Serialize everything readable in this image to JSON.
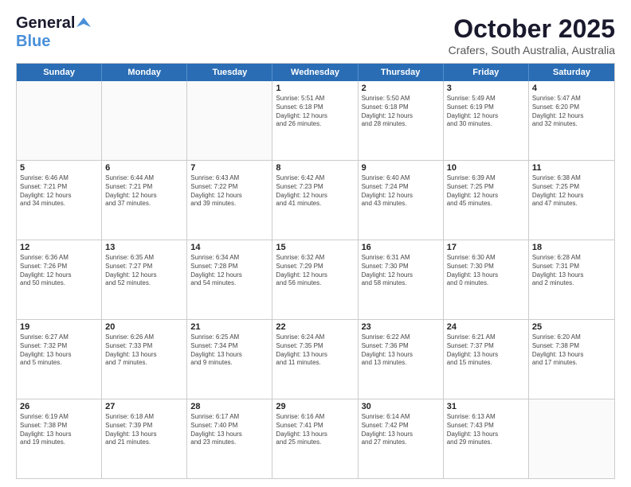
{
  "header": {
    "logo_general": "General",
    "logo_blue": "Blue",
    "month": "October 2025",
    "location": "Crafers, South Australia, Australia"
  },
  "days": [
    "Sunday",
    "Monday",
    "Tuesday",
    "Wednesday",
    "Thursday",
    "Friday",
    "Saturday"
  ],
  "rows": [
    [
      {
        "day": "",
        "info": ""
      },
      {
        "day": "",
        "info": ""
      },
      {
        "day": "",
        "info": ""
      },
      {
        "day": "1",
        "info": "Sunrise: 5:51 AM\nSunset: 6:18 PM\nDaylight: 12 hours\nand 26 minutes."
      },
      {
        "day": "2",
        "info": "Sunrise: 5:50 AM\nSunset: 6:18 PM\nDaylight: 12 hours\nand 28 minutes."
      },
      {
        "day": "3",
        "info": "Sunrise: 5:49 AM\nSunset: 6:19 PM\nDaylight: 12 hours\nand 30 minutes."
      },
      {
        "day": "4",
        "info": "Sunrise: 5:47 AM\nSunset: 6:20 PM\nDaylight: 12 hours\nand 32 minutes."
      }
    ],
    [
      {
        "day": "5",
        "info": "Sunrise: 6:46 AM\nSunset: 7:21 PM\nDaylight: 12 hours\nand 34 minutes."
      },
      {
        "day": "6",
        "info": "Sunrise: 6:44 AM\nSunset: 7:21 PM\nDaylight: 12 hours\nand 37 minutes."
      },
      {
        "day": "7",
        "info": "Sunrise: 6:43 AM\nSunset: 7:22 PM\nDaylight: 12 hours\nand 39 minutes."
      },
      {
        "day": "8",
        "info": "Sunrise: 6:42 AM\nSunset: 7:23 PM\nDaylight: 12 hours\nand 41 minutes."
      },
      {
        "day": "9",
        "info": "Sunrise: 6:40 AM\nSunset: 7:24 PM\nDaylight: 12 hours\nand 43 minutes."
      },
      {
        "day": "10",
        "info": "Sunrise: 6:39 AM\nSunset: 7:25 PM\nDaylight: 12 hours\nand 45 minutes."
      },
      {
        "day": "11",
        "info": "Sunrise: 6:38 AM\nSunset: 7:25 PM\nDaylight: 12 hours\nand 47 minutes."
      }
    ],
    [
      {
        "day": "12",
        "info": "Sunrise: 6:36 AM\nSunset: 7:26 PM\nDaylight: 12 hours\nand 50 minutes."
      },
      {
        "day": "13",
        "info": "Sunrise: 6:35 AM\nSunset: 7:27 PM\nDaylight: 12 hours\nand 52 minutes."
      },
      {
        "day": "14",
        "info": "Sunrise: 6:34 AM\nSunset: 7:28 PM\nDaylight: 12 hours\nand 54 minutes."
      },
      {
        "day": "15",
        "info": "Sunrise: 6:32 AM\nSunset: 7:29 PM\nDaylight: 12 hours\nand 56 minutes."
      },
      {
        "day": "16",
        "info": "Sunrise: 6:31 AM\nSunset: 7:30 PM\nDaylight: 12 hours\nand 58 minutes."
      },
      {
        "day": "17",
        "info": "Sunrise: 6:30 AM\nSunset: 7:30 PM\nDaylight: 13 hours\nand 0 minutes."
      },
      {
        "day": "18",
        "info": "Sunrise: 6:28 AM\nSunset: 7:31 PM\nDaylight: 13 hours\nand 2 minutes."
      }
    ],
    [
      {
        "day": "19",
        "info": "Sunrise: 6:27 AM\nSunset: 7:32 PM\nDaylight: 13 hours\nand 5 minutes."
      },
      {
        "day": "20",
        "info": "Sunrise: 6:26 AM\nSunset: 7:33 PM\nDaylight: 13 hours\nand 7 minutes."
      },
      {
        "day": "21",
        "info": "Sunrise: 6:25 AM\nSunset: 7:34 PM\nDaylight: 13 hours\nand 9 minutes."
      },
      {
        "day": "22",
        "info": "Sunrise: 6:24 AM\nSunset: 7:35 PM\nDaylight: 13 hours\nand 11 minutes."
      },
      {
        "day": "23",
        "info": "Sunrise: 6:22 AM\nSunset: 7:36 PM\nDaylight: 13 hours\nand 13 minutes."
      },
      {
        "day": "24",
        "info": "Sunrise: 6:21 AM\nSunset: 7:37 PM\nDaylight: 13 hours\nand 15 minutes."
      },
      {
        "day": "25",
        "info": "Sunrise: 6:20 AM\nSunset: 7:38 PM\nDaylight: 13 hours\nand 17 minutes."
      }
    ],
    [
      {
        "day": "26",
        "info": "Sunrise: 6:19 AM\nSunset: 7:38 PM\nDaylight: 13 hours\nand 19 minutes."
      },
      {
        "day": "27",
        "info": "Sunrise: 6:18 AM\nSunset: 7:39 PM\nDaylight: 13 hours\nand 21 minutes."
      },
      {
        "day": "28",
        "info": "Sunrise: 6:17 AM\nSunset: 7:40 PM\nDaylight: 13 hours\nand 23 minutes."
      },
      {
        "day": "29",
        "info": "Sunrise: 6:16 AM\nSunset: 7:41 PM\nDaylight: 13 hours\nand 25 minutes."
      },
      {
        "day": "30",
        "info": "Sunrise: 6:14 AM\nSunset: 7:42 PM\nDaylight: 13 hours\nand 27 minutes."
      },
      {
        "day": "31",
        "info": "Sunrise: 6:13 AM\nSunset: 7:43 PM\nDaylight: 13 hours\nand 29 minutes."
      },
      {
        "day": "",
        "info": ""
      }
    ]
  ]
}
